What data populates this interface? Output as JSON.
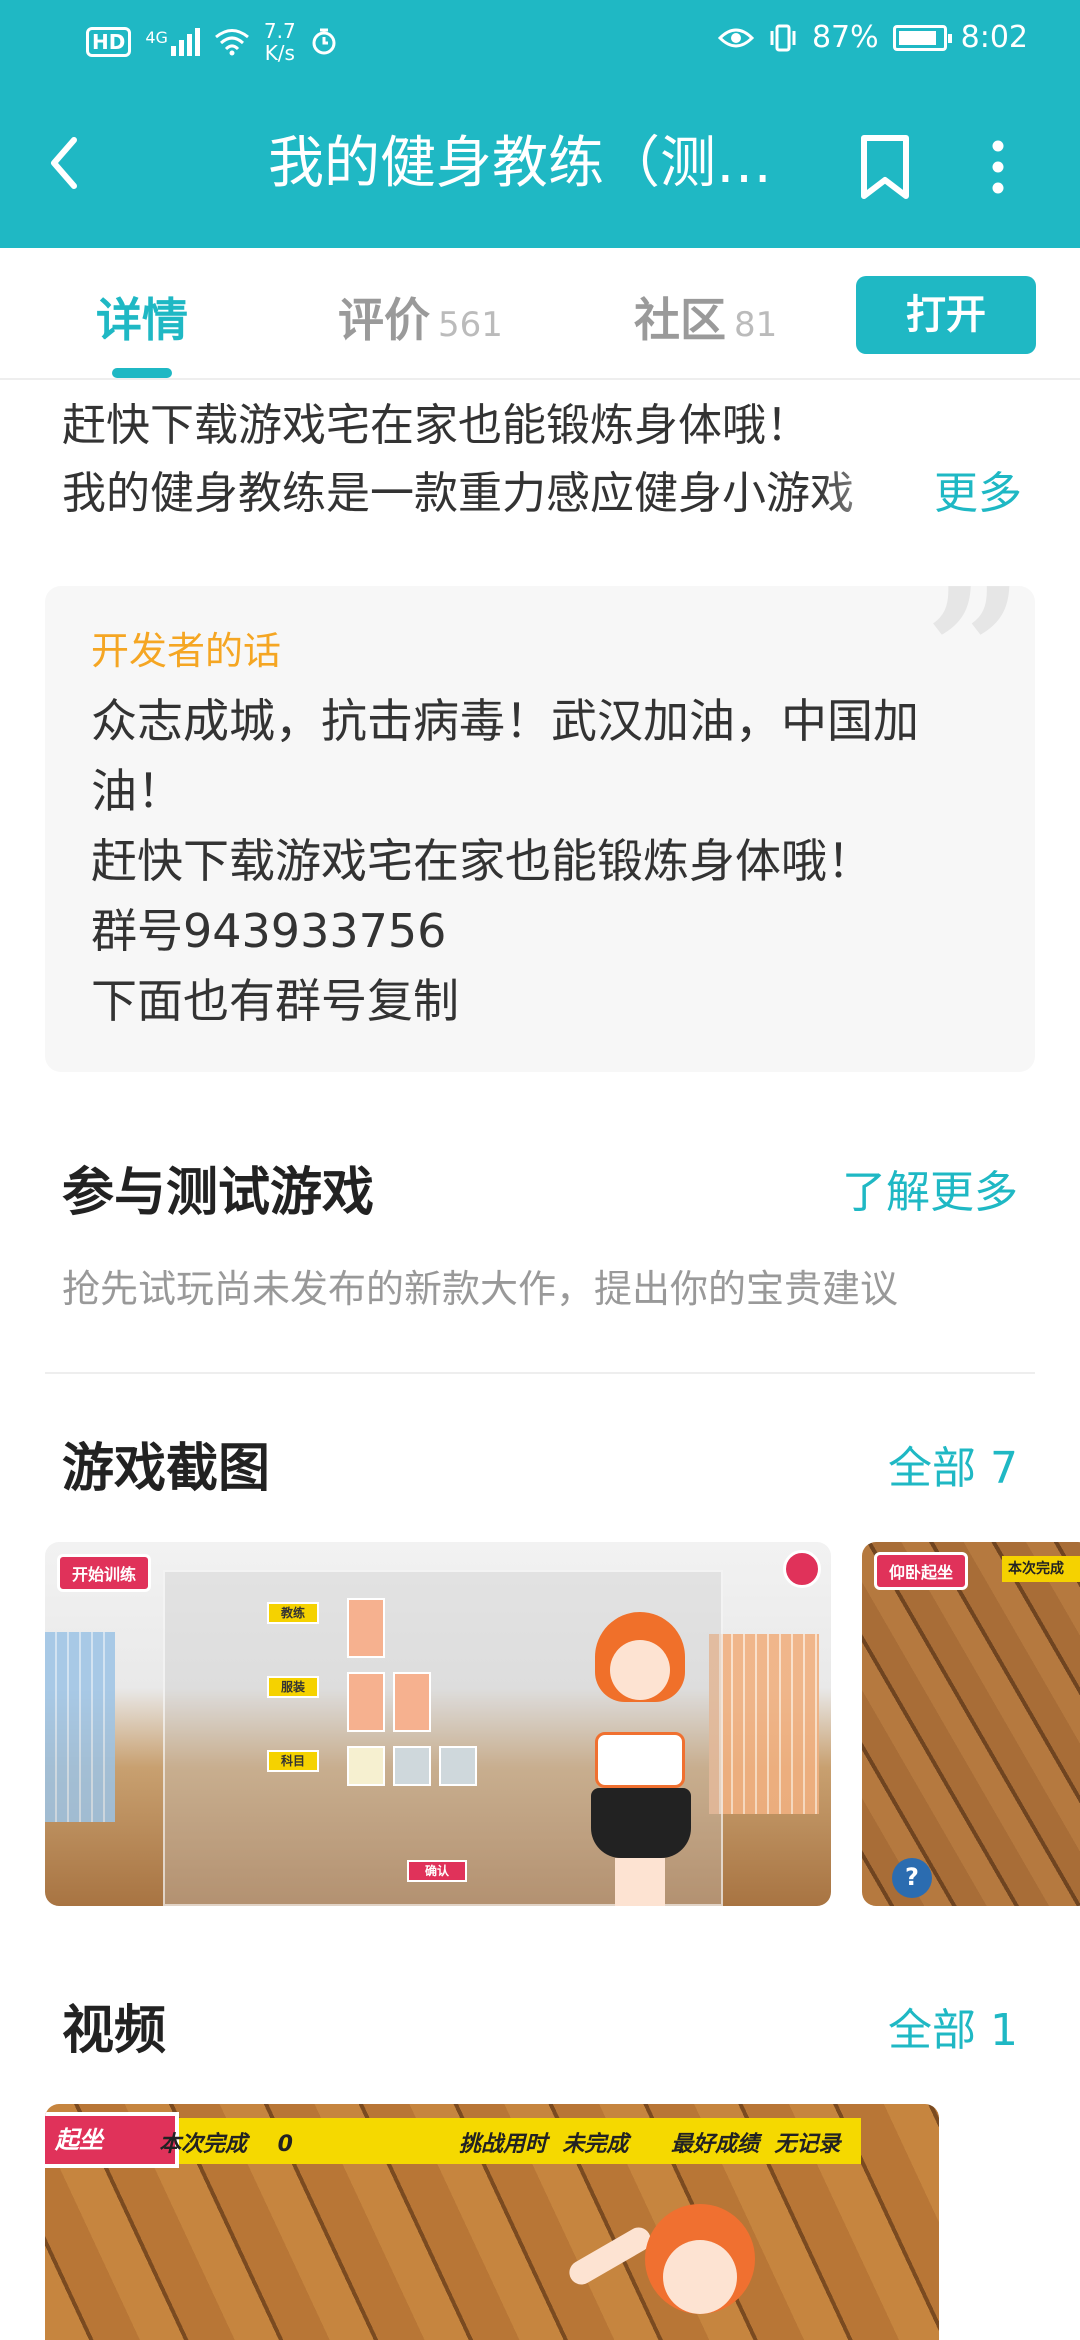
{
  "status_bar": {
    "hd": "HD",
    "network": "4G",
    "speed_value": "7.7",
    "speed_unit": "K/s",
    "battery_percent": "87%",
    "battery_level": 0.87,
    "time": "8:02"
  },
  "app_bar": {
    "title": "我的健身教练（测…"
  },
  "tabs": [
    {
      "label": "详情",
      "count": ""
    },
    {
      "label": "评价",
      "count": "561"
    },
    {
      "label": "社区",
      "count": "81"
    }
  ],
  "open_button": "打开",
  "description": {
    "line1": "赶快下载游戏宅在家也能锻炼身体哦！",
    "line2": "我的健身教练是一款重力感应健身小游戏",
    "more": "更多"
  },
  "developer": {
    "label": "开发者的话",
    "lines": [
      "众志成城，抗击病毒！武汉加油，中国加",
      "油！",
      "赶快下载游戏宅在家也能锻炼身体哦！",
      "群号943933756",
      "下面也有群号复制"
    ]
  },
  "beta": {
    "title": "参与测试游戏",
    "link": "了解更多",
    "subtitle": "抢先试玩尚未发布的新款大作，提出你的宝贵建议"
  },
  "screenshots": {
    "title": "游戏截图",
    "link": "全部 7",
    "shot1": {
      "start_button": "开始训练",
      "menu": [
        "教练",
        "服装",
        "科目"
      ],
      "confirm": "确认"
    },
    "shot2": {
      "button": "仰卧起坐",
      "bar": "本次完成"
    }
  },
  "videos": {
    "title": "视频",
    "link": "全部 1",
    "tag": "起坐",
    "done": "本次完成",
    "done_value": "0",
    "time_label": "挑战用时",
    "time_value": "未完成",
    "best_label": "最好成绩",
    "best_value": "无记录"
  }
}
